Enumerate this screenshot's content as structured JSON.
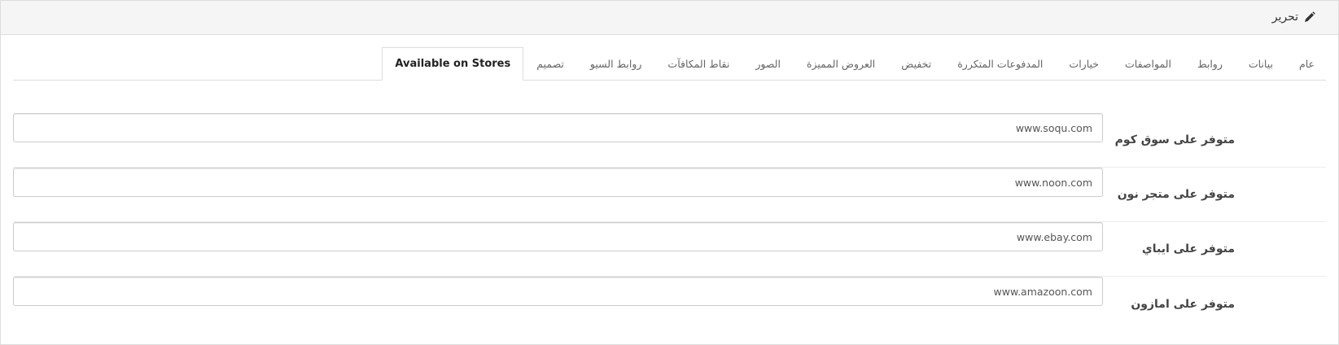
{
  "header": {
    "title": "تحرير",
    "icon": "pencil-icon"
  },
  "tabs": [
    {
      "label": "عام",
      "name": "tab-general"
    },
    {
      "label": "بيانات",
      "name": "tab-data"
    },
    {
      "label": "روابط",
      "name": "tab-links"
    },
    {
      "label": "المواصفات",
      "name": "tab-specifications"
    },
    {
      "label": "خيارات",
      "name": "tab-options"
    },
    {
      "label": "المدفوعات المتكررة",
      "name": "tab-recurring-payments"
    },
    {
      "label": "تخفيض",
      "name": "tab-discount"
    },
    {
      "label": "العروض المميزة",
      "name": "tab-special-offers"
    },
    {
      "label": "الصور",
      "name": "tab-images"
    },
    {
      "label": "نقاط المكافآت",
      "name": "tab-reward-points"
    },
    {
      "label": "روابط السيو",
      "name": "tab-seo-links"
    },
    {
      "label": "تصميم",
      "name": "tab-design"
    },
    {
      "label": "Available on Stores",
      "name": "tab-available-on-stores",
      "active": true
    }
  ],
  "form": {
    "fields": [
      {
        "label": "متوفر على سوق كوم",
        "value": "www.soqu.com"
      },
      {
        "label": "متوفر على متجر نون",
        "value": "www.noon.com"
      },
      {
        "label": "متوفر على ايباي",
        "value": "www.ebay.com"
      },
      {
        "label": "متوفر على امازون",
        "value": "www.amazoon.com"
      }
    ]
  },
  "colors": {
    "heading_bg": "#f5f5f5",
    "border": "#dddddd",
    "active_tab_text": "#222222",
    "tab_text": "#666666"
  }
}
